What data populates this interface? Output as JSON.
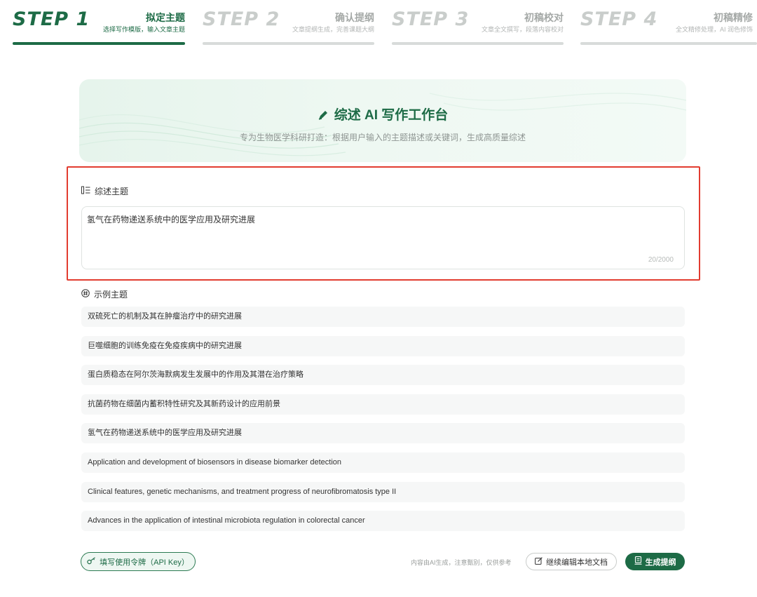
{
  "steps": [
    {
      "num": "STEP 1",
      "title": "拟定主题",
      "desc": "选择写作模版，输入文章主题",
      "active": true
    },
    {
      "num": "STEP 2",
      "title": "确认提纲",
      "desc": "文章提纲生成，完善课题大纲",
      "active": false
    },
    {
      "num": "STEP 3",
      "title": "初稿校对",
      "desc": "文章全文撰写，段落内容校对",
      "active": false
    },
    {
      "num": "STEP 4",
      "title": "初稿精修",
      "desc": "全文精修处理，AI 润色修饰",
      "active": false
    }
  ],
  "hero": {
    "title": "综述 AI 写作工作台",
    "subtitle": "专为生物医学科研打造：根据用户输入的主题描述或关键词，生成高质量综述"
  },
  "topic": {
    "label": "综述主题",
    "value": "氢气在药物递送系统中的医学应用及研究进展",
    "count": "20/2000"
  },
  "examples": {
    "label": "示例主题",
    "items": [
      "双硫死亡的机制及其在肿瘤治疗中的研究进展",
      "巨噬细胞的训练免疫在免疫疾病中的研究进展",
      "蛋白质稳态在阿尔茨海默病发生发展中的作用及其潜在治疗策略",
      "抗菌药物在细菌内蓄积特性研究及其新药设计的应用前景",
      "氢气在药物递送系统中的医学应用及研究进展",
      "Application and development of biosensors in disease biomarker detection",
      "Clinical features, genetic mechanisms, and treatment progress of neurofibromatosis type II",
      "Advances in the application of intestinal microbiota regulation in colorectal cancer"
    ]
  },
  "footer": {
    "api_key_label": "填写使用令牌（API Key）",
    "note": "内容由AI生成，注意甄别，仅供参考",
    "continue_label": "继续编辑本地文档",
    "generate_label": "生成提纲"
  },
  "colors": {
    "primary": "#1d6b46",
    "inactive": "#c9cdcb",
    "highlight_border": "#e23c30"
  },
  "icons": {
    "hero": "pen-icon",
    "topic": "list-icon",
    "examples": "hash-icon",
    "api_key": "key-icon",
    "continue": "edit-icon",
    "generate": "document-icon"
  }
}
